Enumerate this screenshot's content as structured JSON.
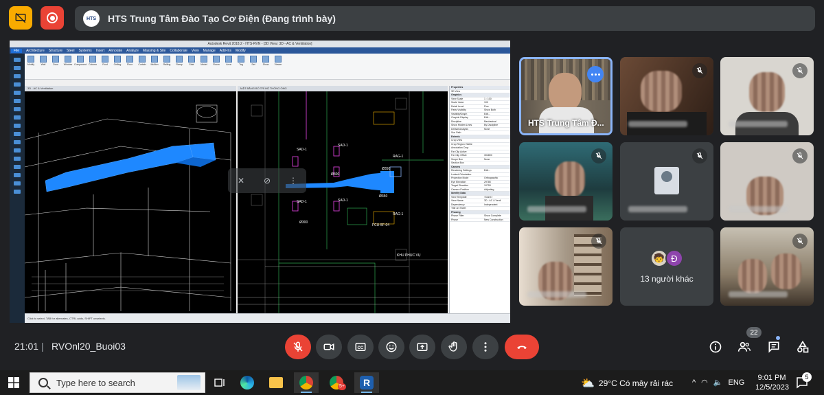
{
  "presenter_bar": {
    "title": "HTS Trung Tâm Đào Tạo Cơ Điện (Đang trình bày)"
  },
  "shared_screen": {
    "window_title": "Autodesk Revit 2018.2 - HTS-RVN - [3D View: 3D - AC & Ventilation]",
    "menu_tabs": [
      "File",
      "Architecture",
      "Structure",
      "Steel",
      "Systems",
      "Insert",
      "Annotate",
      "Analyze",
      "Massing & Site",
      "Collaborate",
      "View",
      "Manage",
      "Add-Ins",
      "Modify"
    ],
    "ribbon_tools": [
      "Modify",
      "Wall",
      "Door",
      "Window",
      "Component",
      "Column",
      "Roof",
      "Ceiling",
      "Floor",
      "Curtain",
      "Mullion",
      "Railing",
      "Ramp",
      "Stair",
      "Model",
      "Room",
      "Area",
      "Tag",
      "Set",
      "Show",
      "Viewer"
    ],
    "left_view_tab": "3D - AC & Ventilation",
    "right_view_tab": "MẶT BẰNG BỐ TRÍ HỆ THỐNG ỐNG",
    "properties_title": "Properties",
    "properties_type": "3D View",
    "properties_rows": [
      {
        "k": "Graphics",
        "sec": true
      },
      {
        "k": "View Scale",
        "v": "1 : 100"
      },
      {
        "k": "Scale Value",
        "v": "100"
      },
      {
        "k": "Detail Level",
        "v": "Fine"
      },
      {
        "k": "Parts Visibility",
        "v": "Show Both"
      },
      {
        "k": "Visibility/Graph",
        "v": "Edit..."
      },
      {
        "k": "Graphic Display",
        "v": "Edit..."
      },
      {
        "k": "Discipline",
        "v": "Mechanical"
      },
      {
        "k": "Show Hidden Lines",
        "v": "By Discipline"
      },
      {
        "k": "Default Analysis",
        "v": "None"
      },
      {
        "k": "Sun Path",
        "v": ""
      },
      {
        "k": "Extents",
        "sec": true
      },
      {
        "k": "Crop View",
        "v": ""
      },
      {
        "k": "Crop Region Visible",
        "v": ""
      },
      {
        "k": "Annotation Crop",
        "v": ""
      },
      {
        "k": "Far Clip Active",
        "v": ""
      },
      {
        "k": "Far Clip Offset",
        "v": "304800"
      },
      {
        "k": "Scope Box",
        "v": "None"
      },
      {
        "k": "Section Box",
        "v": ""
      },
      {
        "k": "Camera",
        "sec": true
      },
      {
        "k": "Rendering Settings",
        "v": "Edit..."
      },
      {
        "k": "Locked Orientation",
        "v": ""
      },
      {
        "k": "Projection Mode",
        "v": "Orthographic"
      },
      {
        "k": "Eye Elevation",
        "v": "29785"
      },
      {
        "k": "Target Elevation",
        "v": "10753"
      },
      {
        "k": "Camera Position",
        "v": "Adjusting"
      },
      {
        "k": "Identity Data",
        "sec": true
      },
      {
        "k": "View Template",
        "v": "<None>"
      },
      {
        "k": "View Name",
        "v": "3D - AC & Venti"
      },
      {
        "k": "Dependency",
        "v": "Independent"
      },
      {
        "k": "Title on Sheet",
        "v": ""
      },
      {
        "k": "Phasing",
        "sec": true
      },
      {
        "k": "Phase Filter",
        "v": "Show Complete"
      },
      {
        "k": "Phase",
        "v": "New Construction"
      }
    ],
    "status_text": "Click to select, TAB for alternates, CTRL adds, SHIFT unselects.",
    "duct_labels": [
      "SAD-1",
      "SAD-1",
      "SAD-1",
      "SAD-1",
      "RAG-1",
      "RAG-1",
      "Ø300",
      "Ø300",
      "Ø350",
      "Ø350",
      "FCU-5F-04",
      "KHU PHỤC VỤ"
    ]
  },
  "participants": [
    {
      "name": "HTS Trung Tâm Đ...",
      "active": true,
      "muted": false
    },
    {
      "name": "",
      "muted": true
    },
    {
      "name": "",
      "muted": true
    },
    {
      "name": "",
      "muted": true
    },
    {
      "name": "",
      "muted": true
    },
    {
      "name": "",
      "muted": true
    },
    {
      "name": "",
      "muted": true
    },
    {
      "name": "",
      "muted": false,
      "others": true
    },
    {
      "name": "",
      "muted": true
    }
  ],
  "others_tile": {
    "avatar_letter": "Đ",
    "label": "13 người khác"
  },
  "meet_controls": {
    "clock": "21:01",
    "separator": "|",
    "meeting_code": "RVOnl20_Buoi03",
    "people_count": "22"
  },
  "taskbar": {
    "search_placeholder": "Type here to search",
    "weather": "29°C  Có mây rải rác",
    "language": "ENG",
    "time": "9:01 PM",
    "date": "12/5/2023",
    "notification_count": "5"
  },
  "colors": {
    "meet_bg": "#202124",
    "tile_bg": "#3c4043",
    "accent_blue": "#8ab4f8",
    "record_red": "#ea4335",
    "present_yellow": "#f9ab00",
    "duct_blue": "#1e88ff"
  }
}
